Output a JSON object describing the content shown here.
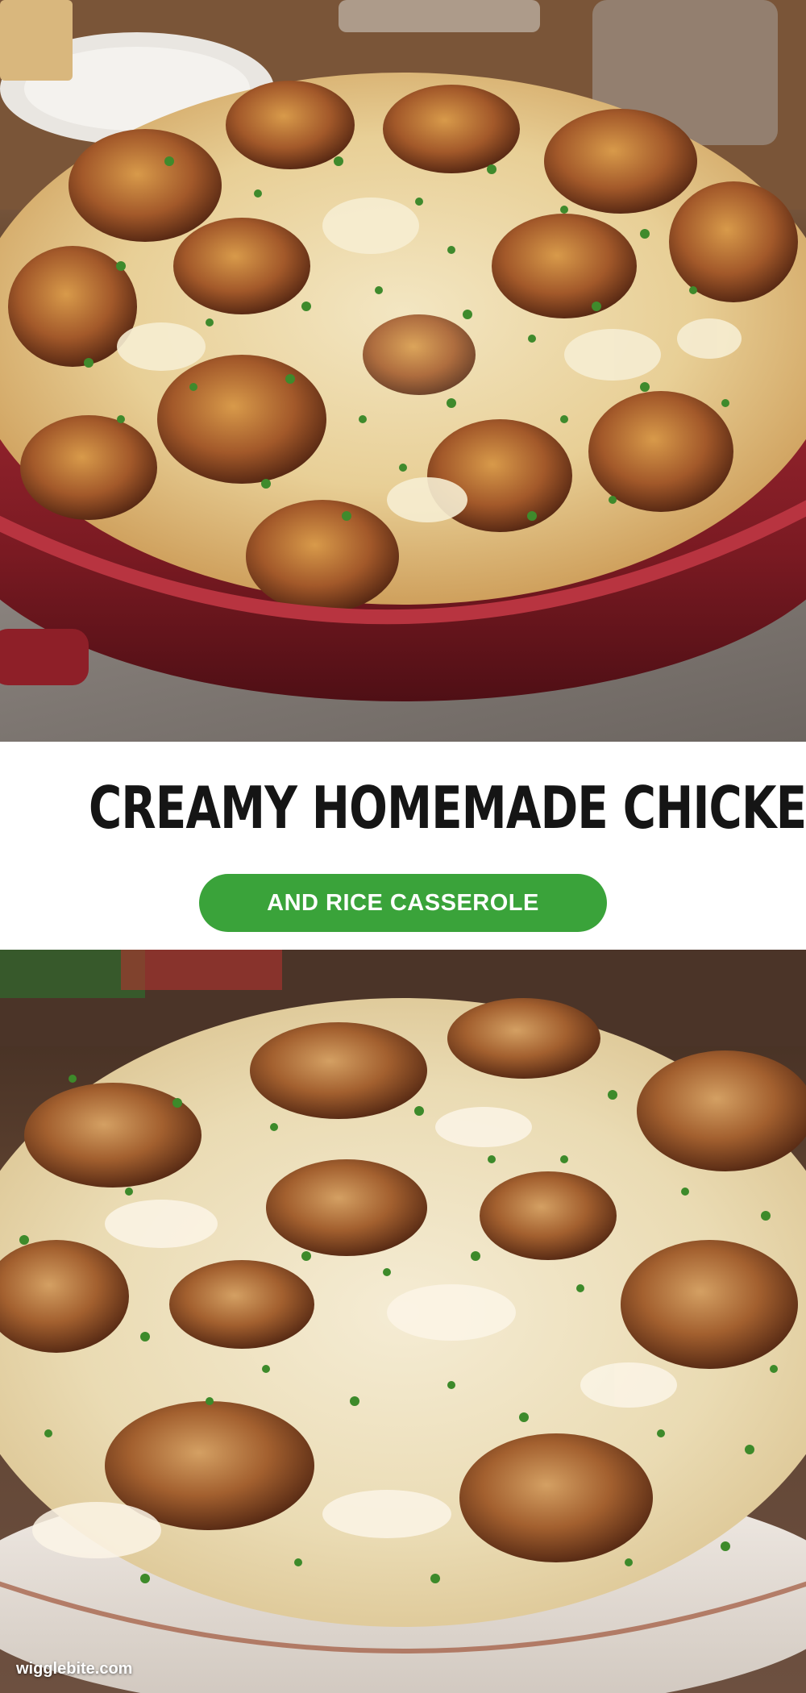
{
  "title_band": {
    "title": "CREAMY HOMEMADE CHICKEN",
    "subtitle": "AND RICE CASSEROLE"
  },
  "watermark": "wigglebite.com",
  "colors": {
    "pill": "#3aa33a",
    "title_text": "#151515",
    "dish_top": "#8e1f28",
    "dish_bottom": "#efe9e3"
  }
}
